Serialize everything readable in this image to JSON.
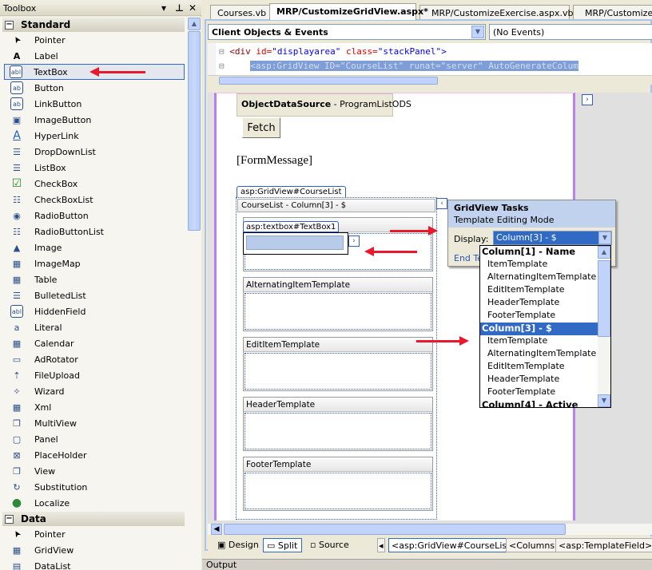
{
  "toolbox": {
    "title": "Toolbox",
    "controls": {
      "dropdown": "▾",
      "pin": "⊥",
      "close": "✕"
    },
    "categories": [
      {
        "name": "Standard",
        "items": [
          {
            "label": "Pointer",
            "icon": "pointer-icon"
          },
          {
            "label": "Label",
            "icon": "label-icon"
          },
          {
            "label": "TextBox",
            "icon": "textbox-icon",
            "selected": true
          },
          {
            "label": "Button",
            "icon": "button-icon"
          },
          {
            "label": "LinkButton",
            "icon": "linkbutton-icon"
          },
          {
            "label": "ImageButton",
            "icon": "imagebutton-icon"
          },
          {
            "label": "HyperLink",
            "icon": "hyperlink-icon"
          },
          {
            "label": "DropDownList",
            "icon": "dropdownlist-icon"
          },
          {
            "label": "ListBox",
            "icon": "listbox-icon"
          },
          {
            "label": "CheckBox",
            "icon": "checkbox-icon"
          },
          {
            "label": "CheckBoxList",
            "icon": "checkboxlist-icon"
          },
          {
            "label": "RadioButton",
            "icon": "radiobutton-icon"
          },
          {
            "label": "RadioButtonList",
            "icon": "radiobuttonlist-icon"
          },
          {
            "label": "Image",
            "icon": "image-icon"
          },
          {
            "label": "ImageMap",
            "icon": "imagemap-icon"
          },
          {
            "label": "Table",
            "icon": "table-icon"
          },
          {
            "label": "BulletedList",
            "icon": "bulletedlist-icon"
          },
          {
            "label": "HiddenField",
            "icon": "hiddenfield-icon"
          },
          {
            "label": "Literal",
            "icon": "literal-icon"
          },
          {
            "label": "Calendar",
            "icon": "calendar-icon"
          },
          {
            "label": "AdRotator",
            "icon": "adrotator-icon"
          },
          {
            "label": "FileUpload",
            "icon": "fileupload-icon"
          },
          {
            "label": "Wizard",
            "icon": "wizard-icon"
          },
          {
            "label": "Xml",
            "icon": "xml-icon"
          },
          {
            "label": "MultiView",
            "icon": "multiview-icon"
          },
          {
            "label": "Panel",
            "icon": "panel-icon"
          },
          {
            "label": "PlaceHolder",
            "icon": "placeholder-icon"
          },
          {
            "label": "View",
            "icon": "view-icon"
          },
          {
            "label": "Substitution",
            "icon": "substitution-icon"
          },
          {
            "label": "Localize",
            "icon": "localize-icon"
          }
        ]
      },
      {
        "name": "Data",
        "items": [
          {
            "label": "Pointer",
            "icon": "pointer-icon"
          },
          {
            "label": "GridView",
            "icon": "gridview-icon"
          },
          {
            "label": "DataList",
            "icon": "datalist-icon"
          }
        ]
      }
    ]
  },
  "tabs": [
    {
      "label": "Courses.vb",
      "active": false
    },
    {
      "label": "MRP/CustomizeGridView.aspx*",
      "active": true
    },
    {
      "label": "MRP/CustomizeExercise.aspx.vb",
      "active": false
    },
    {
      "label": "MRP/CustomizeEx",
      "active": false
    }
  ],
  "nav": {
    "objects": "Client Objects & Events",
    "events": "(No Events)"
  },
  "code": {
    "line1": {
      "tag": "<div ",
      "attr1": "id=",
      "val1": "\"displayarea\"",
      "attr2": " class=",
      "val2": "\"stackPanel\"",
      "close": ">"
    },
    "line2": "<asp:GridView ID=\"CourseList\" runat=\"server\" AutoGenerateColum"
  },
  "design": {
    "ods": {
      "bold": "ObjectDataSource",
      "rest": " - ProgramListODS"
    },
    "fetch_button": "Fetch",
    "form_message": "[FormMessage]",
    "gridview_tag": "asp:GridView#CourseList",
    "gridview_header": "CourseList - Column[3] - $",
    "textbox_tag": "asp:textbox#TextBox1",
    "templates": [
      "ItemTemplate",
      "AlternatingItemTemplate",
      "EditItemTemplate",
      "HeaderTemplate",
      "FooterTemplate"
    ]
  },
  "tasks": {
    "title": "GridView Tasks",
    "subtitle": "Template Editing Mode",
    "display_label": "Display:",
    "display_value": "Column[3] - $",
    "end_link": "End Te",
    "options": [
      {
        "label": "Column[1] - Name",
        "group": true
      },
      {
        "label": "ItemTemplate"
      },
      {
        "label": "AlternatingItemTemplate"
      },
      {
        "label": "EditItemTemplate"
      },
      {
        "label": "HeaderTemplate"
      },
      {
        "label": "FooterTemplate"
      },
      {
        "label": "Column[3] - $",
        "group": true,
        "selected": true
      },
      {
        "label": "ItemTemplate"
      },
      {
        "label": "AlternatingItemTemplate"
      },
      {
        "label": "EditItemTemplate"
      },
      {
        "label": "HeaderTemplate"
      },
      {
        "label": "FooterTemplate"
      },
      {
        "label": "Column[4] - Active",
        "group": true
      }
    ]
  },
  "viewbar": {
    "design": "Design",
    "split": "Split",
    "source": "Source",
    "crumbs": [
      "<asp:GridView#CourseList>",
      "<Columns>",
      "<asp:TemplateField>"
    ]
  },
  "output": "Output",
  "colors": {
    "accent": "#316ac5",
    "arrow": "#e8192c",
    "surface_border": "#b77ff0"
  }
}
